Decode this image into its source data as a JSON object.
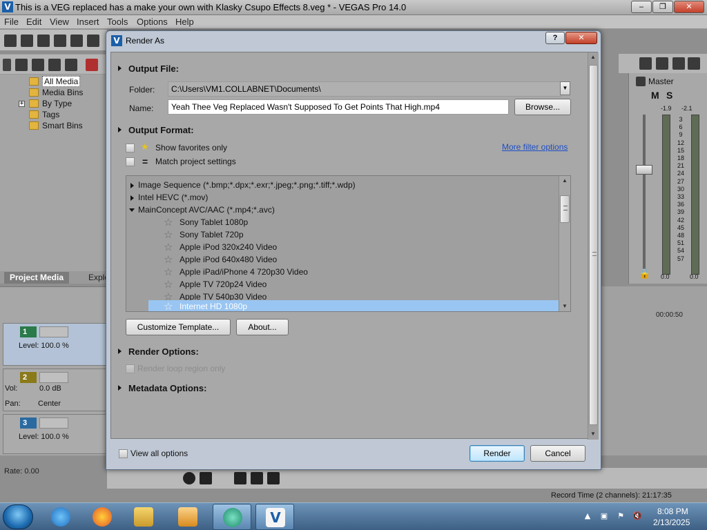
{
  "window": {
    "title": "This is a VEG replaced has a make your own with Klasky Csupo Effects 8.veg * - VEGAS Pro 14.0",
    "minimize_glyph": "‒",
    "maximize_glyph": "❐",
    "close_glyph": "✕"
  },
  "menu": [
    "File",
    "Edit",
    "View",
    "Insert",
    "Tools",
    "Options",
    "Help"
  ],
  "project_media": {
    "tree": [
      {
        "label": "All Media",
        "selected": true
      },
      {
        "label": "Media Bins"
      },
      {
        "label": "By Type",
        "expander": "+"
      },
      {
        "label": "Tags"
      },
      {
        "label": "Smart Bins"
      }
    ],
    "tabs": [
      "Project Media",
      "Explo"
    ]
  },
  "tracks": [
    {
      "number": "1",
      "text": "Level: 100.0 %"
    },
    {
      "number": "2",
      "vol_label": "Vol:",
      "vol_value": "0.0 dB",
      "pan_label": "Pan:",
      "pan_value": "Center"
    },
    {
      "number": "3",
      "text": "Level: 100.0 %"
    }
  ],
  "rate": "Rate: 0.00",
  "master": {
    "label": "Master",
    "m_label": "M",
    "s_label": "S",
    "peak_left": "-1.9",
    "peak_right": "-2.1",
    "scale": [
      "3",
      "6",
      "9",
      "12",
      "15",
      "18",
      "21",
      "24",
      "27",
      "30",
      "33",
      "36",
      "39",
      "42",
      "45",
      "48",
      "51",
      "54",
      "57"
    ],
    "value_left": "0.0",
    "value_right": "0.0"
  },
  "timeline": {
    "ruler": "00:00:50"
  },
  "record_time": "Record Time (2 channels): 21:17:35",
  "dialog": {
    "title": "Render As",
    "help_label": "?",
    "close_glyph": "✕",
    "output_file": {
      "heading": "Output File:",
      "folder_label": "Folder:",
      "folder_value": "C:\\Users\\VM1.COLLABNET\\Documents\\",
      "name_label": "Name:",
      "name_value": "Yeah Thee Veg Replaced Wasn't Supposed To Get Points That High.mp4",
      "browse_label": "Browse..."
    },
    "output_format": {
      "heading": "Output Format:",
      "show_favorites_label": "Show favorites only",
      "match_project_label": "Match project settings",
      "more_filter_label": "More filter options",
      "formats": [
        {
          "label": "Image Sequence (*.bmp;*.dpx;*.exr;*.jpeg;*.png;*.tiff;*.wdp)",
          "expanded": false
        },
        {
          "label": "Intel HEVC (*.mov)",
          "expanded": false
        },
        {
          "label": "MainConcept AVC/AAC (*.mp4;*.avc)",
          "expanded": true
        }
      ],
      "templates": [
        {
          "label": "Sony Tablet 1080p"
        },
        {
          "label": "Sony Tablet 720p"
        },
        {
          "label": "Apple iPod 320x240 Video"
        },
        {
          "label": "Apple iPod 640x480 Video"
        },
        {
          "label": "Apple iPad/iPhone 4 720p30 Video"
        },
        {
          "label": "Apple TV 720p24 Video"
        },
        {
          "label": "Apple TV 540p30 Video"
        },
        {
          "label": "Internet HD 1080p",
          "selected": true
        }
      ],
      "customize_label": "Customize Template...",
      "about_label": "About..."
    },
    "render_options": {
      "heading": "Render Options:",
      "loop_region_label": "Render loop region only"
    },
    "metadata_options": {
      "heading": "Metadata Options:"
    },
    "view_all_label": "View all options",
    "render_label": "Render",
    "cancel_label": "Cancel"
  },
  "taskbar": {
    "apps": [
      "start-orb",
      "internet-explorer",
      "firefox",
      "file-explorer",
      "video-player",
      "media-center",
      "vegas-pro"
    ],
    "time": "8:08 PM",
    "date": "2/13/2025"
  },
  "colors": {
    "selection": "#99c5f2",
    "link": "#1d4fc7",
    "dialog_frame": "#bfc8d4",
    "close_red": "#c2412a"
  }
}
